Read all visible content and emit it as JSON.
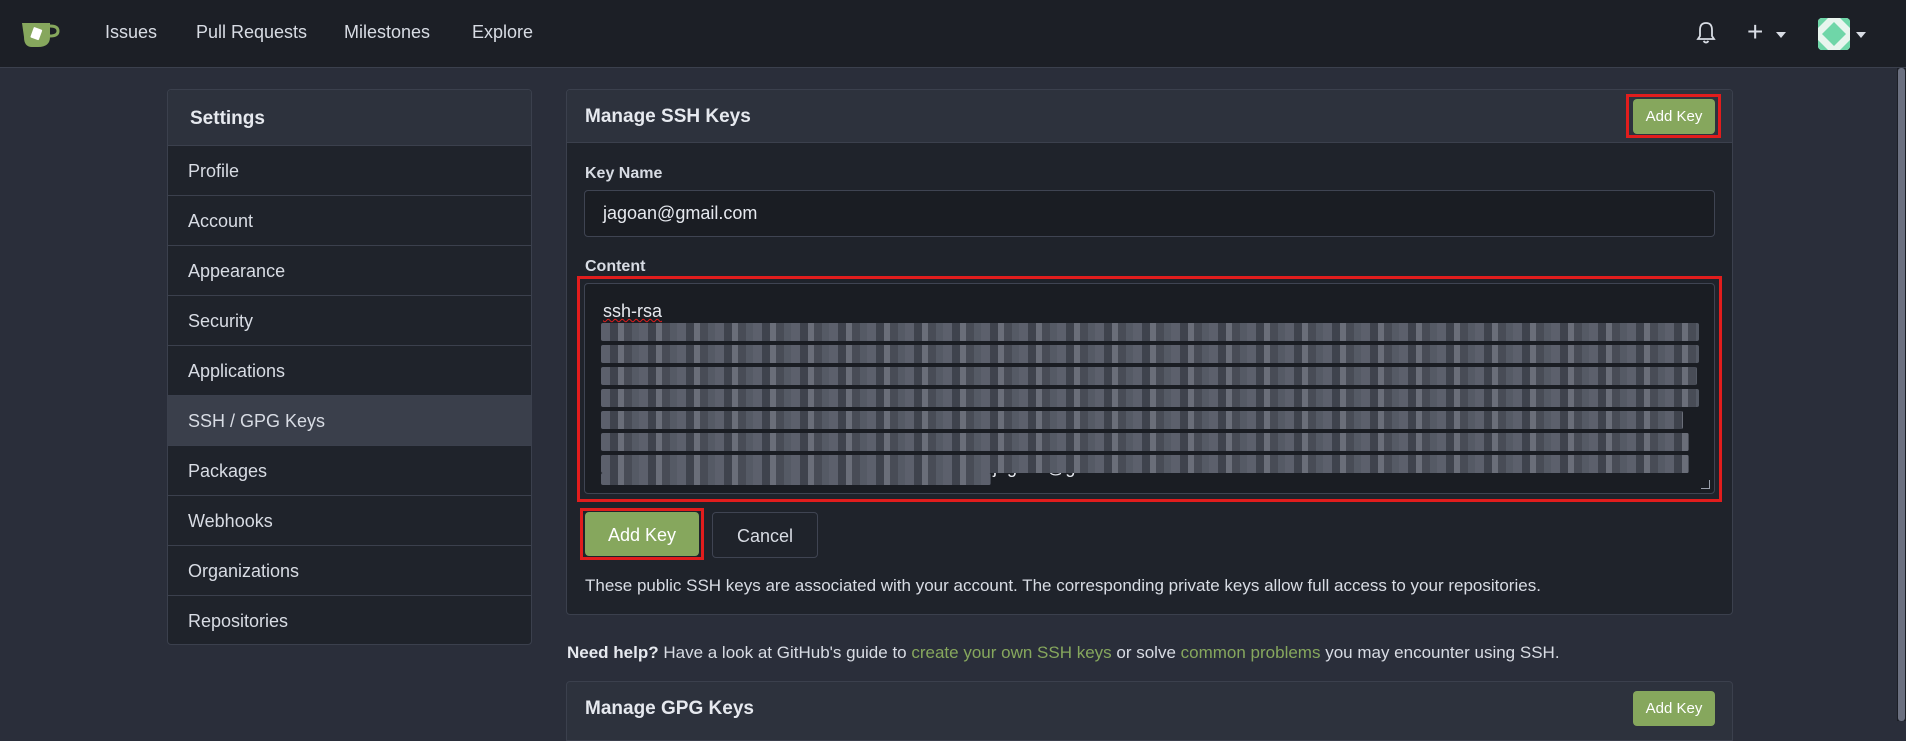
{
  "nav": {
    "items": [
      "Issues",
      "Pull Requests",
      "Milestones",
      "Explore"
    ],
    "plus_symbol": "+"
  },
  "sidebar": {
    "title": "Settings",
    "items": [
      {
        "label": "Profile"
      },
      {
        "label": "Account"
      },
      {
        "label": "Appearance"
      },
      {
        "label": "Security"
      },
      {
        "label": "Applications"
      },
      {
        "label": "SSH / GPG Keys",
        "active": true
      },
      {
        "label": "Packages"
      },
      {
        "label": "Webhooks"
      },
      {
        "label": "Organizations"
      },
      {
        "label": "Repositories"
      }
    ]
  },
  "ssh_panel": {
    "title": "Manage SSH Keys",
    "add_key_header_label": "Add Key",
    "key_name_label": "Key Name",
    "key_name_value": "jagoan@gmail.com",
    "content_label": "Content",
    "content_prefix": "ssh-rsa",
    "content_suffix": "jagoan@gmail.com",
    "add_key_label": "Add Key",
    "cancel_label": "Cancel",
    "info_text": "These public SSH keys are associated with your account. The corresponding private keys allow full access to your repositories."
  },
  "help": {
    "bold": "Need help?",
    "text1": " Have a look at GitHub's guide to ",
    "link1": "create your own SSH keys",
    "text2": " or solve ",
    "link2": "common problems",
    "text3": " you may encounter using SSH."
  },
  "gpg_panel": {
    "title": "Manage GPG Keys",
    "add_key_label": "Add Key"
  },
  "colors": {
    "accent_green": "#86a75d",
    "highlight_red": "#e11d1d",
    "background": "#2a2e3a"
  }
}
